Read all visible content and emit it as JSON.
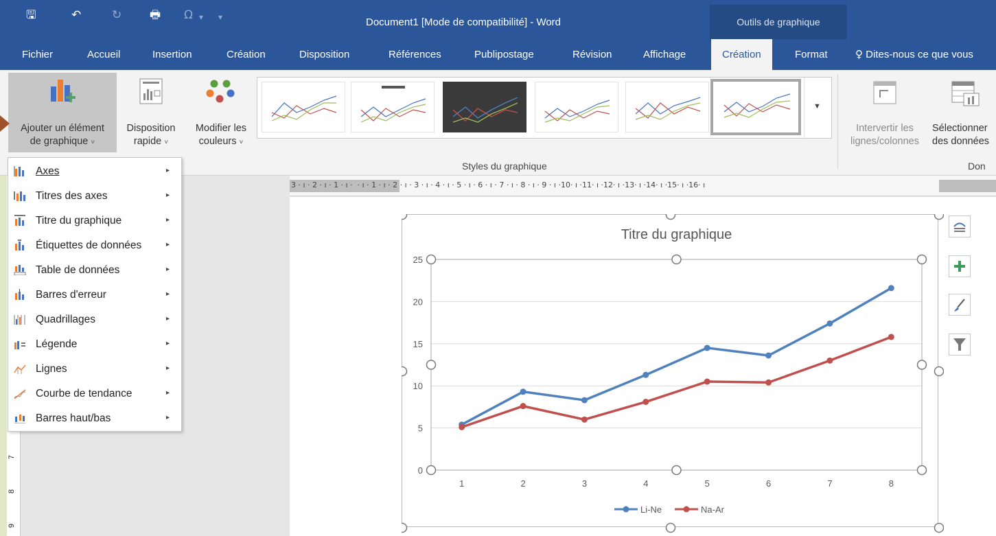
{
  "quick_access": {
    "save": "🖫",
    "undo": "↶",
    "redo": "↻",
    "print": "🖶",
    "symbol": "Ω",
    "symbol_caret": "▾",
    "customize": "▾"
  },
  "window": {
    "title": "Document1 [Mode de compatibilité] - Word",
    "context_tab": "Outils de graphique"
  },
  "tabs": [
    "Fichier",
    "Accueil",
    "Insertion",
    "Création",
    "Disposition",
    "Références",
    "Publipostage",
    "Révision",
    "Affichage",
    "Création",
    "Format"
  ],
  "active_tab_index": 9,
  "tell_me": "Dites-nous ce que vous",
  "ribbon": {
    "add_element": {
      "line1": "Ajouter un élément",
      "line2": "de graphique",
      "caret": "˅"
    },
    "quick_layout": {
      "line1": "Disposition",
      "line2": "rapide",
      "caret": "˅"
    },
    "change_colors": {
      "line1": "Modifier les",
      "line2": "couleurs",
      "caret": "˅"
    },
    "chart_styles_label": "Styles du graphique",
    "switch_row_col": {
      "line1": "Intervertir les",
      "line2": "lignes/colonnes"
    },
    "select_data": {
      "line1": "Sélectionner",
      "line2": "des données"
    },
    "data_label": "Don"
  },
  "ruler": {
    "text": "3 · ı · 2 · ı · 1 · ı ·  · ı · 1 · ı · 2 · ı · 3 · ı · 4 · ı · 5 · ı · 6 · ı · 7 · ı · 8 · ı · 9 · ı ·10· ı ·11· ı ·12· ı ·13· ı ·14· ı ·15· ı ·16· ı"
  },
  "vruler": {
    "labels": [
      "7",
      "8",
      "9"
    ]
  },
  "menu": {
    "items": [
      {
        "label": "Axes"
      },
      {
        "label": "Titres des axes"
      },
      {
        "label": "Titre du graphique"
      },
      {
        "label": "Étiquettes de données"
      },
      {
        "label": "Table de données"
      },
      {
        "label": "Barres d'erreur"
      },
      {
        "label": "Quadrillages"
      },
      {
        "label": "Légende"
      },
      {
        "label": "Lignes"
      },
      {
        "label": "Courbe de tendance"
      },
      {
        "label": "Barres haut/bas"
      }
    ],
    "arrow": "▸"
  },
  "chart_data": {
    "type": "line",
    "title": "Titre du graphique",
    "x": [
      1,
      2,
      3,
      4,
      5,
      6,
      7,
      8
    ],
    "ylim": [
      0,
      25
    ],
    "yticks": [
      0,
      5,
      10,
      15,
      20,
      25
    ],
    "grid": true,
    "legend": "bottom",
    "series": [
      {
        "name": "Li-Ne",
        "color": "#4f81bd",
        "values": [
          5.4,
          9.3,
          8.3,
          11.3,
          14.5,
          13.6,
          17.4,
          21.6
        ]
      },
      {
        "name": "Na-Ar",
        "color": "#c0504d",
        "values": [
          5.1,
          7.6,
          6.0,
          8.1,
          10.5,
          10.4,
          13.0,
          15.8
        ]
      }
    ]
  },
  "colors": {
    "accent": "#2b579a",
    "selected_button": "#c6c6c6"
  }
}
